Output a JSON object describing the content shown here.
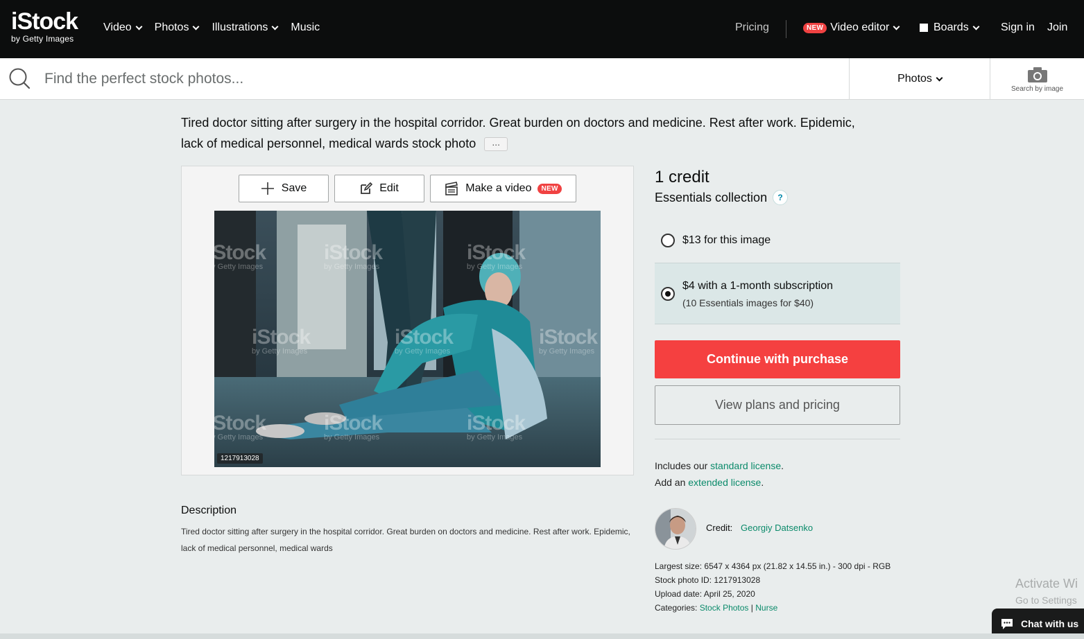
{
  "brand": {
    "logo": "iStock",
    "logo_sub": "by Getty Images"
  },
  "nav": {
    "items": [
      "Video",
      "Photos",
      "Illustrations",
      "Music"
    ],
    "pricing": "Pricing",
    "new_badge": "NEW",
    "video_editor": "Video editor",
    "boards": "Boards",
    "sign_in": "Sign in",
    "join": "Join"
  },
  "search": {
    "placeholder": "Find the perfect stock photos...",
    "type": "Photos",
    "by_image": "Search by image"
  },
  "title": {
    "line": "Tired doctor sitting after surgery in the hospital corridor. Great burden on doctors and medicine. Rest after work. Epidemic, lack of medical personnel, medical wards stock photo",
    "more": "..."
  },
  "toolbar": {
    "save": "Save",
    "edit": "Edit",
    "make_video": "Make a video",
    "new_badge": "NEW"
  },
  "image": {
    "id_tag": "1217913028",
    "watermark": "iStock",
    "watermark_sub": "by Getty Images"
  },
  "description": {
    "heading": "Description",
    "text": "Tired doctor sitting after surgery in the hospital corridor. Great burden on doctors and medicine. Rest after work. Epidemic, lack of medical personnel, medical wards"
  },
  "purchase": {
    "credit": "1 credit",
    "collection": "Essentials collection",
    "help": "?",
    "option1": "$13 for this image",
    "option2": "$4 with a 1-month subscription",
    "option2_sub": "(10 Essentials images for $40)",
    "continue": "Continue with purchase",
    "plans": "View plans and pricing",
    "includes_prefix": "Includes our ",
    "standard_license": "standard license",
    "period": ".",
    "add_prefix": "Add an ",
    "extended_license": "extended license",
    "period2": "."
  },
  "credit": {
    "label": "Credit:",
    "name": "Georgiy Datsenko"
  },
  "meta": {
    "largest_label": "Largest size:",
    "largest_value": "6547 x 4364 px (21.82 x 14.55 in.) - 300 dpi - RGB",
    "id_label": "Stock photo ID:",
    "id_value": "1217913028",
    "upload_label": "Upload date:",
    "upload_value": "April 25, 2020",
    "categories_label": "Categories:",
    "cat1": "Stock Photos",
    "sep": "|",
    "cat2": "Nurse"
  },
  "system": {
    "activate": "Activate Wi",
    "activate_sub": "Go to Settings",
    "chat": "Chat with us"
  }
}
